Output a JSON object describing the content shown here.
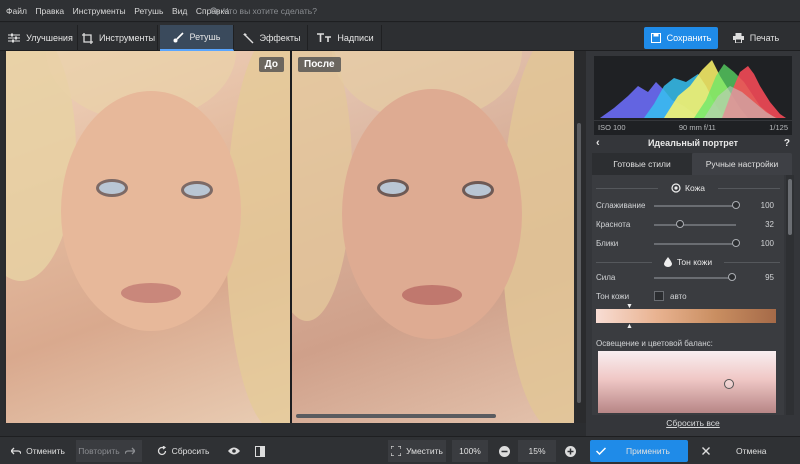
{
  "menu": {
    "items": [
      "Файл",
      "Правка",
      "Инструменты",
      "Ретушь",
      "Вид",
      "Справка"
    ],
    "search_placeholder": "Что вы хотите сделать?"
  },
  "toolbar": {
    "tabs": [
      {
        "label": "Улучшения",
        "icon": "sliders-icon",
        "active": false
      },
      {
        "label": "Инструменты",
        "icon": "crop-icon",
        "active": false
      },
      {
        "label": "Ретушь",
        "icon": "brush-icon",
        "active": true
      },
      {
        "label": "Эффекты",
        "icon": "magic-wand-icon",
        "active": false
      },
      {
        "label": "Надписи",
        "icon": "text-icon",
        "active": false
      }
    ],
    "save_label": "Сохранить",
    "print_label": "Печать"
  },
  "canvas": {
    "before_label": "До",
    "after_label": "После"
  },
  "panel": {
    "histogram": {
      "iso": "ISO 100",
      "focal": "90 mm f/11",
      "shutter": "1/125"
    },
    "title": "Идеальный портрет",
    "tabs": [
      "Готовые стили",
      "Ручные настройки"
    ],
    "active_tab": 1,
    "skin_section": "Кожа",
    "sliders": [
      {
        "label": "Сглаживание",
        "value": "100",
        "level": 1.0
      },
      {
        "label": "Краснота",
        "value": "32",
        "level": 0.32
      },
      {
        "label": "Блики",
        "value": "100",
        "level": 1.0
      }
    ],
    "tone_section": "Тон кожи",
    "strength": {
      "label": "Сила",
      "value": "95",
      "level": 0.95
    },
    "skin_tone_label": "Тон кожи",
    "auto_label": "авто",
    "auto_checked": false,
    "lighting_label": "Освещение и цветовой баланс:",
    "reset_label": "Сбросить все"
  },
  "bottombar": {
    "undo": "Отменить",
    "redo": "Повторить",
    "reset": "Сбросить",
    "fit": "Уместить",
    "zoom_100": "100%",
    "zoom_value": "15%",
    "apply": "Применить",
    "cancel": "Отмена"
  },
  "colors": {
    "accent": "#1f8be8",
    "panel_bg": "#34363a",
    "app_bg": "#2b2d30"
  }
}
